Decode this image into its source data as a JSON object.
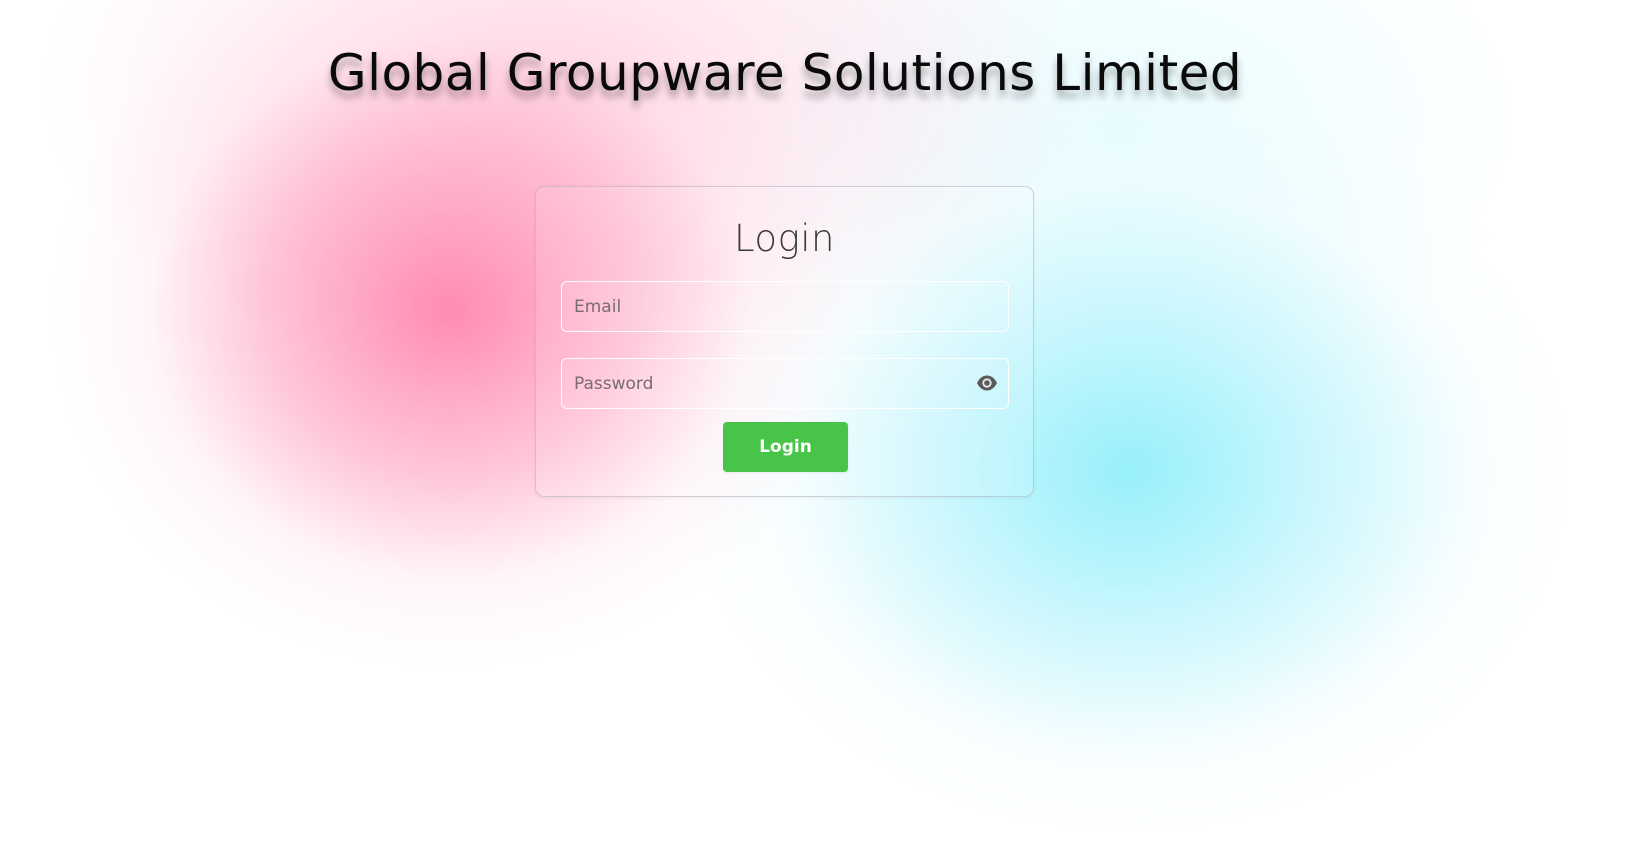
{
  "header": {
    "title": "Global Groupware Solutions Limited"
  },
  "login_form": {
    "title": "Login",
    "email": {
      "value": "",
      "placeholder": "Email"
    },
    "password": {
      "value": "",
      "placeholder": "Password",
      "toggle_icon": "eye-icon"
    },
    "submit_label": "Login"
  },
  "colors": {
    "button": "#48c548",
    "background_accent_pink": "#ff8ab0",
    "background_accent_cyan": "#95f0fa"
  }
}
